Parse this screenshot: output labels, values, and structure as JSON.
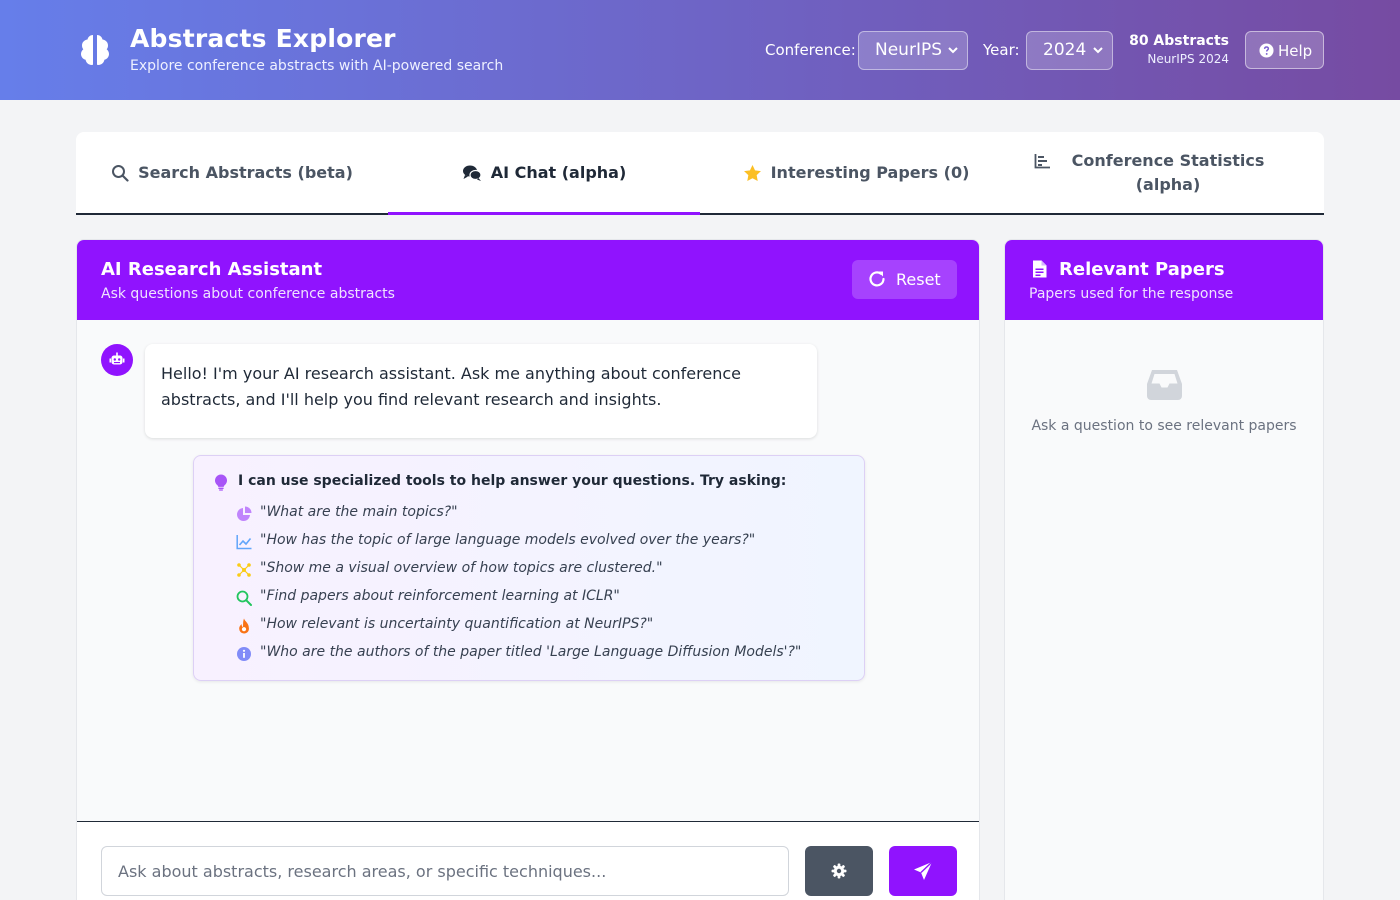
{
  "header": {
    "title": "Abstracts Explorer",
    "subtitle": "Explore conference abstracts with AI-powered search",
    "conference_label": "Conference:",
    "conference_value": "NeurIPS",
    "year_label": "Year:",
    "year_value": "2024",
    "count_main": "80 Abstracts",
    "count_sub": "NeurIPS 2024",
    "help_label": "Help"
  },
  "tabs": [
    {
      "label": "Search Abstracts (beta)",
      "icon": "search-icon"
    },
    {
      "label": "AI Chat (alpha)",
      "icon": "chat-bubbles-icon",
      "active": true
    },
    {
      "label": "Interesting Papers (0)",
      "icon": "star-icon"
    },
    {
      "label": "Conference Statistics (alpha)",
      "icon": "bar-chart-icon"
    }
  ],
  "chat": {
    "title": "AI Research Assistant",
    "subtitle": "Ask questions about conference abstracts",
    "reset_label": "Reset",
    "welcome_message": "Hello! I'm your AI research assistant. Ask me anything about conference abstracts, and I'll help you find relevant research and insights.",
    "tips_heading": "I can use specialized tools to help answer your questions. Try asking:",
    "tips": [
      {
        "text": "\"What are the main topics?\"",
        "icon": "pie-chart-icon",
        "color": "#c084fc"
      },
      {
        "text": "\"How has the topic of large language models evolved over the years?\"",
        "icon": "line-chart-icon",
        "color": "#60a5fa"
      },
      {
        "text": "\"Show me a visual overview of how topics are clustered.\"",
        "icon": "cluster-icon",
        "color": "#facc15"
      },
      {
        "text": "\"Find papers about reinforcement learning at ICLR\"",
        "icon": "search-icon",
        "color": "#22c55e"
      },
      {
        "text": "\"How relevant is uncertainty quantification at NeurIPS?\"",
        "icon": "fire-icon",
        "color": "#f97316"
      },
      {
        "text": "\"Who are the authors of the paper titled 'Large Language Diffusion Models'?\"",
        "icon": "info-icon",
        "color": "#818cf8"
      }
    ],
    "input_placeholder": "Ask about abstracts, research areas, or specific techniques..."
  },
  "papers": {
    "title": "Relevant Papers",
    "subtitle": "Papers used for the response",
    "empty_text": "Ask a question to see relevant papers"
  },
  "colors": {
    "accent": "#9013fe",
    "header_gradient_start": "#667eea",
    "header_gradient_end": "#764ba2",
    "star": "#fbbf24"
  }
}
